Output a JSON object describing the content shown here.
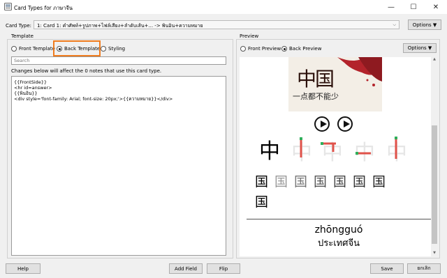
{
  "window": {
    "title": "Card Types for ภาษาจีน",
    "minimize": "—",
    "maximize": "☐",
    "close": "✕"
  },
  "card_type": {
    "label": "Card Type:",
    "selected": "1: Card 1: คำศัพท์+รูปภาพ+ไฟล์เสียง+ลำดับเส้น+... -> พินอิน+ความหมาย",
    "options_button": "Options ▼"
  },
  "template": {
    "legend": "Template",
    "radios": [
      {
        "label": "Front Template",
        "checked": false
      },
      {
        "label": "Back Template",
        "checked": true
      },
      {
        "label": "Styling",
        "checked": false
      }
    ],
    "search_placeholder": "Search",
    "changes_note": "Changes below will affect the 0 notes that use this card type.",
    "editor_lines": [
      "{{FrontSide}}",
      "",
      "<hr id=answer>",
      "",
      "{{พินอิน}}",
      "<div style='font-family: Arial; font-size: 20px;'>{{ความหมาย}}</div>"
    ]
  },
  "preview": {
    "legend": "Preview",
    "radios": [
      {
        "label": "Front Preview",
        "checked": false
      },
      {
        "label": "Back Preview",
        "checked": true
      }
    ],
    "options_button": "Options ▼",
    "image_title": "中国",
    "image_subtitle": "一点都不能少",
    "big_char": "中",
    "stroke_chars": [
      "中",
      "中",
      "中",
      "中"
    ],
    "guo_chars": [
      "国",
      "国",
      "国",
      "国",
      "国",
      "国",
      "国",
      "国"
    ],
    "pinyin": "zhōngguó",
    "meaning": "ประเทศจีน"
  },
  "buttons": {
    "help": "Help",
    "add_field": "Add Field",
    "flip": "Flip",
    "save": "Save",
    "cancel": "ยกเลิก"
  },
  "colors": {
    "highlight": "#f07c1e",
    "stroke_red": "#e0524a",
    "stroke_green": "#2fae5a"
  }
}
